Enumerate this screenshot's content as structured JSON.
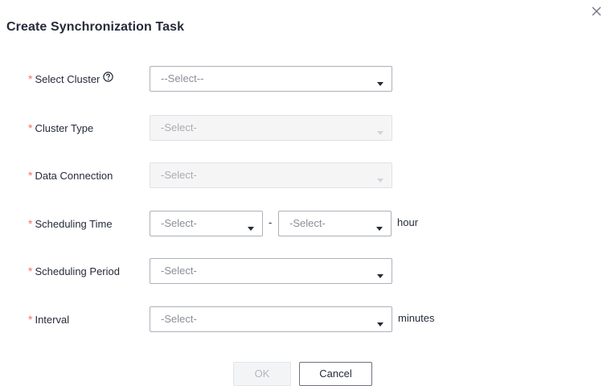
{
  "dialog": {
    "title": "Create Synchronization Task",
    "close_icon": "close-icon"
  },
  "form": {
    "required_mark": "*",
    "select_cluster": {
      "label": "Select Cluster",
      "value": "--Select--",
      "help_icon": "question-circle-icon"
    },
    "cluster_type": {
      "label": "Cluster Type",
      "value": "-Select-"
    },
    "data_connection": {
      "label": "Data Connection",
      "value": "-Select-"
    },
    "scheduling_time": {
      "label": "Scheduling Time",
      "start_value": "-Select-",
      "separator": "-",
      "end_value": "-Select-",
      "unit": "hour"
    },
    "scheduling_period": {
      "label": "Scheduling Period",
      "value": "-Select-"
    },
    "interval": {
      "label": "Interval",
      "value": "-Select-",
      "unit": "minutes"
    }
  },
  "footer": {
    "ok_label": "OK",
    "cancel_label": "Cancel"
  },
  "colors": {
    "required": "#f66f6a",
    "text": "#252b3a",
    "placeholder": "#8a8e99",
    "disabled_bg": "#f5f5f6"
  }
}
